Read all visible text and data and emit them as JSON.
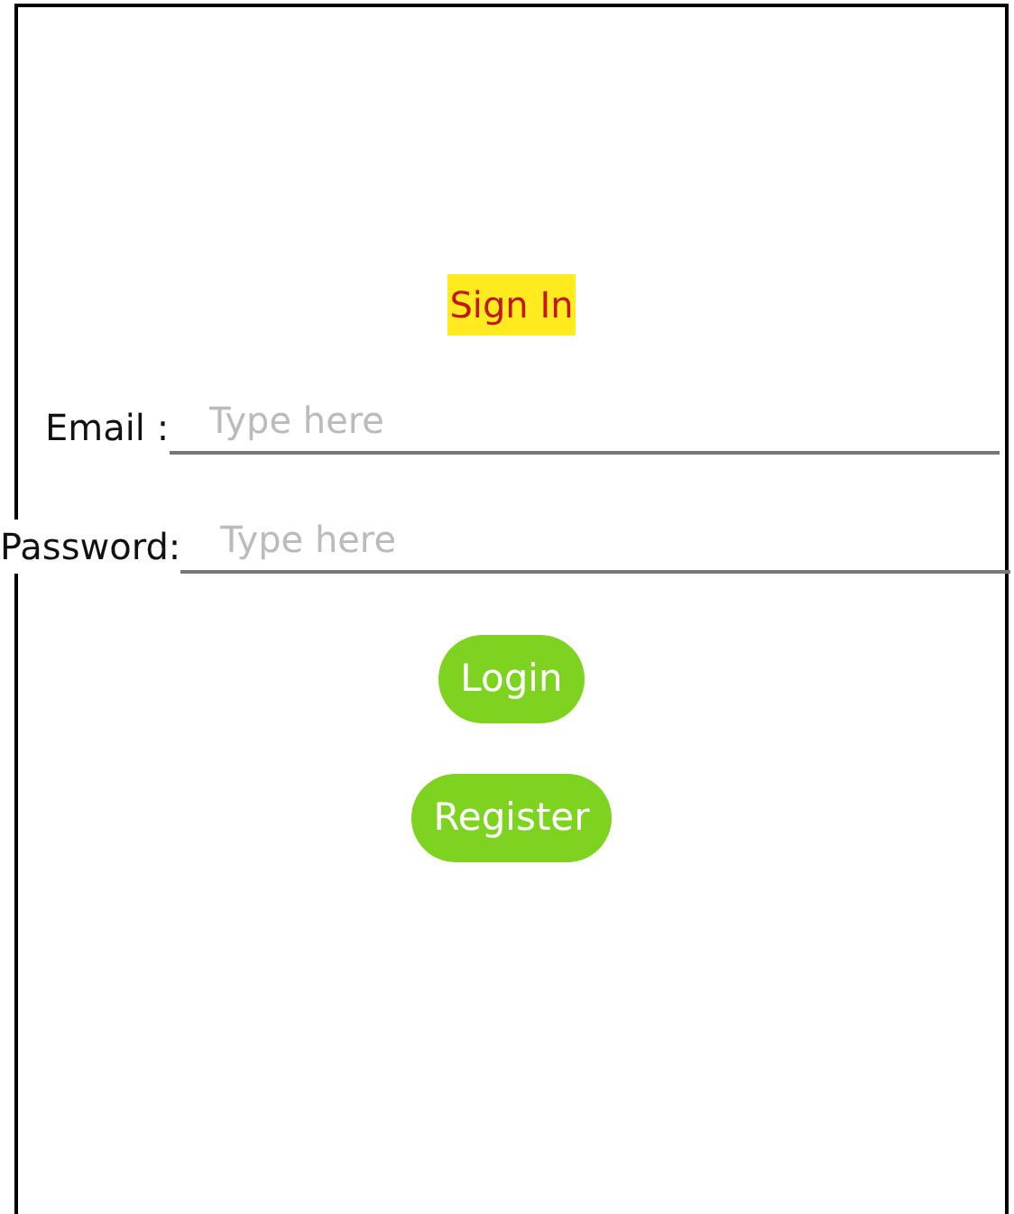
{
  "title": "Sign In",
  "fields": [
    {
      "label": "Email :",
      "placeholder": "Type here"
    },
    {
      "label": "Password:",
      "placeholder": "Type here"
    }
  ],
  "buttons": [
    "Login",
    "Register"
  ]
}
